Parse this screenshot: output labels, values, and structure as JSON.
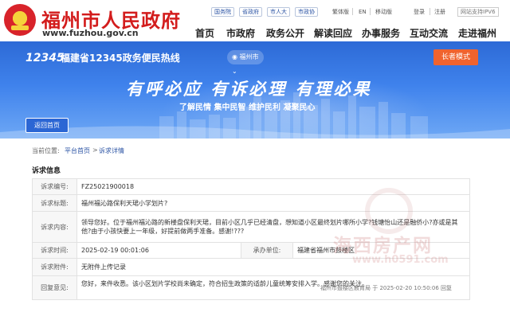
{
  "header": {
    "site_title": "福州市人民政府",
    "site_url": "www.fuzhou.gov.cn",
    "quick_links": [
      "国务院",
      "省政府",
      "市人大",
      "市政协"
    ],
    "utilities": {
      "traditional": "繁体版",
      "english": "EN",
      "mobile": "移动版",
      "login": "登录",
      "register": "注册"
    },
    "ipv6_badge": "网站支持IPV6",
    "nav": [
      "首页",
      "市政府",
      "政务公开",
      "解读回应",
      "办事服务",
      "互动交流",
      "走进福州"
    ]
  },
  "banner": {
    "hotline_logo": "12345",
    "hotline_title": "福建省12345政务便民热线",
    "city_select": "福州市",
    "elder_mode": "长者模式",
    "slogan_main": "有呼必应  有诉必理  有理必果",
    "slogan_sub": "了解民情  集中民智  维护民利  凝聚民心",
    "back_home": "返回首页"
  },
  "breadcrumb": {
    "prefix": "当前位置:",
    "home": "平台首页",
    "sep": ">",
    "current": "诉求详情"
  },
  "section_title": "诉求信息",
  "complaint": {
    "number_label": "诉求编号:",
    "number": "FZ25021900018",
    "title_label": "诉求标题:",
    "title": "福州福沁路保利天珺小学划片?",
    "content_label": "诉求内容:",
    "content": "领导您好。位于福州福沁路的新楼盘保利天珺，目前小区几乎已经清盘，想知道小区最终划片哪所小学?钱塘怡山还是融侨小?亦或是其他?由于小孩快要上一年级，好提前做两手准备。感谢!???",
    "time_label": "诉求时间:",
    "time": "2025-02-19 00:01:06",
    "dept_label": "承办单位:",
    "dept": "福建省福州市鼓楼区",
    "attach_label": "诉求附件:",
    "attach": "无附件上传记录",
    "reply_label": "回复意见:",
    "reply": "您好，来件收悉。该小区划片学校尚未确定，符合招生政策的适龄儿童统筹安排入学。感谢您的关注。",
    "reply_meta": "福州市鼓楼区教育局 于 2025-02-20 10:50:06 回复"
  },
  "watermark": {
    "brand": "海西房产网",
    "url": "www.h0591.com"
  },
  "colors": {
    "brand_red": "#d31c1c",
    "banner_blue": "#3f82ec",
    "elder_orange": "#f0632e",
    "link_blue": "#2d55a5"
  }
}
